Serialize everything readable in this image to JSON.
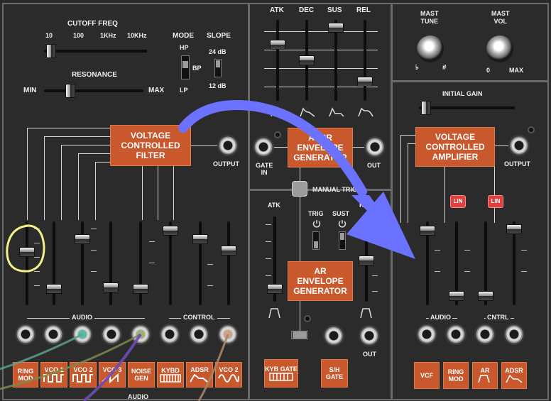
{
  "vcf": {
    "cutoff_label": "CUTOFF FREQ",
    "cutoff_scale": [
      "10",
      "100",
      "1KHz",
      "10KHz"
    ],
    "resonance_label": "RESONANCE",
    "resonance_min": "MIN",
    "resonance_max": "MAX",
    "mode_label": "MODE",
    "mode_options": [
      "HP",
      "BP",
      "LP"
    ],
    "slope_label": "SLOPE",
    "slope_options": [
      "24 dB",
      "12 dB"
    ],
    "module_label": "VOLTAGE\nCONTROLLED\nFILTER",
    "output_label": "OUTPUT",
    "audio_label": "AUDIO",
    "control_label": "CONTROL",
    "input_buttons": [
      "RING MOD",
      "VCO 1",
      "VCO 2",
      "VCO 3",
      "NOISE GEN",
      "KYBD",
      "ADSR",
      "VCO 2"
    ],
    "bottom_audio_label": "AUDIO"
  },
  "adsr": {
    "slider_labels": [
      "ATK",
      "DEC",
      "SUS",
      "REL"
    ],
    "module_label": "ADSR\nENVELOPE\nGENERATOR",
    "gate_label": "GATE\nIN",
    "out_label": "OUT"
  },
  "ar": {
    "manual_trig_label": "MANUAL TRIG",
    "atk_label": "ATK",
    "rel_label": "REL",
    "trig_label": "TRIG",
    "sust_label": "SUST",
    "module_label": "AR\nENVELOPE\nGENERATOR",
    "out_label": "OUT",
    "kyb_gate_label": "KYB GATE",
    "sh_gate_label": "S/H\nGATE"
  },
  "master": {
    "tune_label": "MAST\nTUNE",
    "vol_label": "MAST\nVOL",
    "flat_symbol": "♭",
    "sharp_symbol": "#",
    "vol_min": "0",
    "vol_max": "MAX"
  },
  "vca": {
    "initial_gain_label": "INITIAL GAIN",
    "module_label": "VOLTAGE\nCONTROLLED\nAMPLIFIER",
    "output_label": "OUTPUT",
    "lin_label": "LIN",
    "audio_label": "AUDIO",
    "cntrl_label": "CNTRL",
    "input_buttons": [
      "VCF",
      "RING MOD",
      "AR",
      "ADSR"
    ]
  },
  "colors": {
    "module": "#c9582c",
    "annotation_arrow": "#6b72ff",
    "highlight_circle": "#f5f08a",
    "lin_button": "#e04040"
  },
  "icons": {
    "square_wave": "square-wave-icon",
    "saw_wave": "saw-wave-icon",
    "sine_wave": "sine-wave-icon",
    "keyboard": "keyboard-icon",
    "envelope": "envelope-icon"
  }
}
